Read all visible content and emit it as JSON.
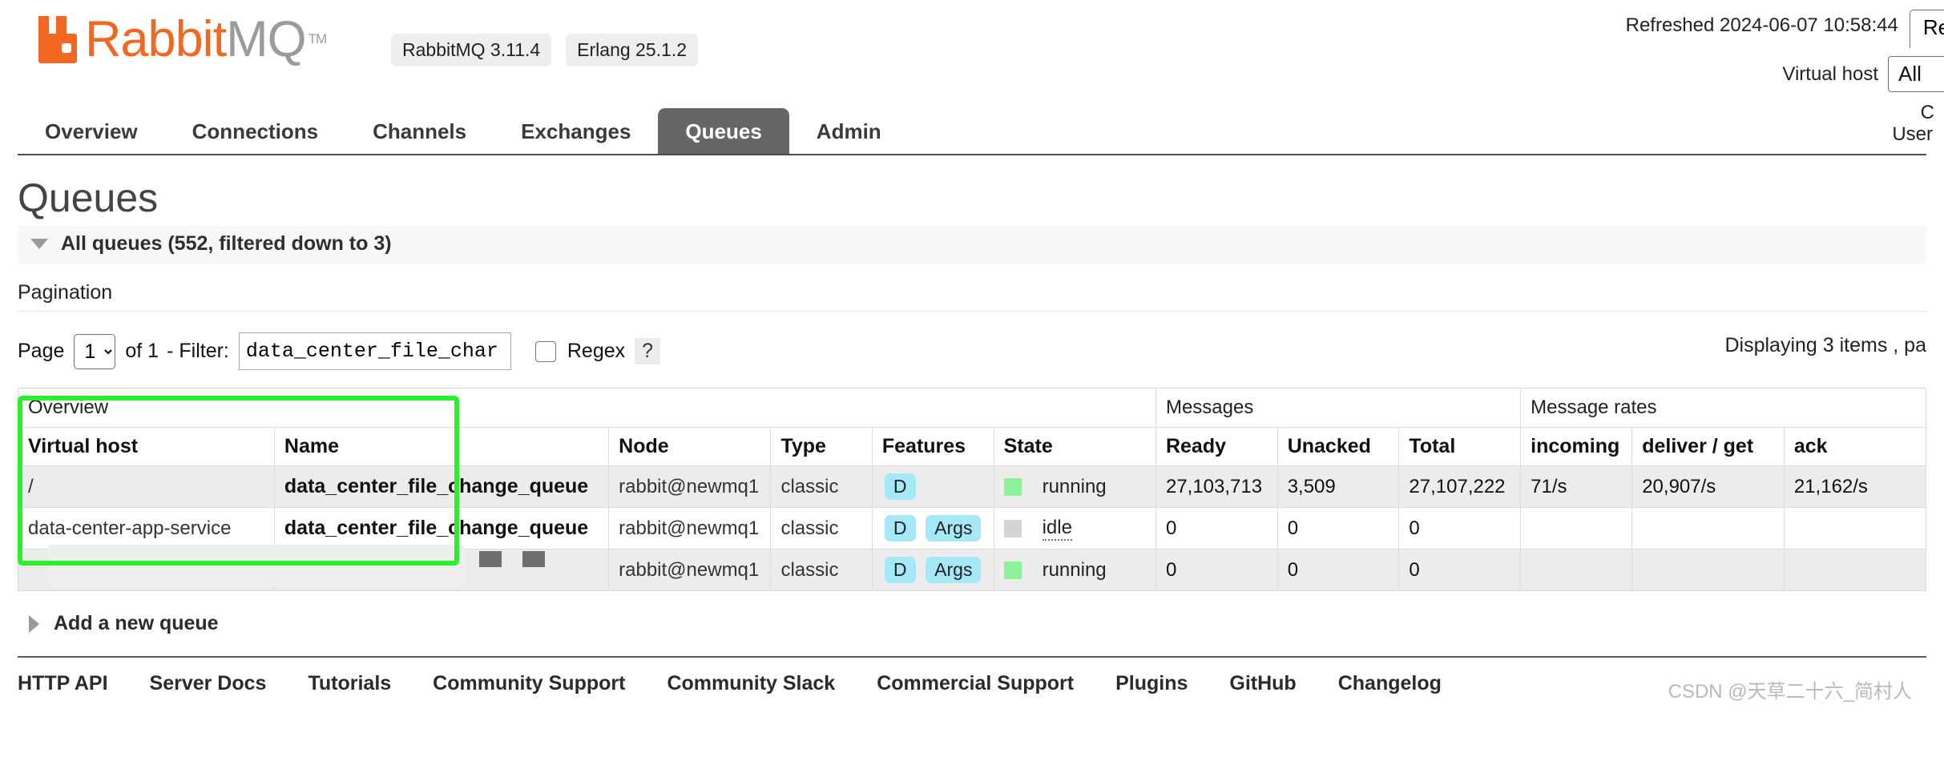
{
  "header": {
    "logo_rabbit": "Rabbit",
    "logo_mq": "MQ",
    "logo_tm": "TM",
    "version_rabbitmq": "RabbitMQ 3.11.4",
    "version_erlang": "Erlang 25.1.2",
    "refreshed_text": "Refreshed 2024-06-07 10:58:44",
    "refresh_button": "Refr",
    "vhost_label": "Virtual host",
    "vhost_value": "All",
    "cluster_partial": "C",
    "user_partial": "User"
  },
  "nav": {
    "tabs": [
      {
        "label": "Overview",
        "active": false
      },
      {
        "label": "Connections",
        "active": false
      },
      {
        "label": "Channels",
        "active": false
      },
      {
        "label": "Exchanges",
        "active": false
      },
      {
        "label": "Queues",
        "active": true
      },
      {
        "label": "Admin",
        "active": false
      }
    ]
  },
  "page": {
    "title": "Queues",
    "section_heading": "All queues (552, filtered down to 3)",
    "pagination_label": "Pagination"
  },
  "pagination": {
    "page_word": "Page",
    "page_value": "1",
    "of_text": "of 1",
    "filter_label": "- Filter:",
    "filter_value": "data_center_file_char",
    "regex_label": "Regex",
    "help": "?",
    "displaying": "Displaying 3 items , pa"
  },
  "table": {
    "group_headers": [
      {
        "label": "Overview",
        "span": 6
      },
      {
        "label": "Messages",
        "span": 3
      },
      {
        "label": "Message rates",
        "span": 3
      }
    ],
    "columns": [
      "Virtual host",
      "Name",
      "Node",
      "Type",
      "Features",
      "State",
      "Ready",
      "Unacked",
      "Total",
      "incoming",
      "deliver / get",
      "ack"
    ],
    "rows": [
      {
        "vhost": "/",
        "name": "data_center_file_change_queue",
        "node": "rabbit@newmq1",
        "type": "classic",
        "features": [
          "D"
        ],
        "state": "running",
        "state_kind": "running",
        "ready": "27,103,713",
        "unacked": "3,509",
        "total": "27,107,222",
        "incoming": "71/s",
        "deliver_get": "20,907/s",
        "ack": "21,162/s"
      },
      {
        "vhost": "data-center-app-service",
        "name": "data_center_file_change_queue",
        "node": "rabbit@newmq1",
        "type": "classic",
        "features": [
          "D",
          "Args"
        ],
        "state": "idle",
        "state_kind": "idle",
        "ready": "0",
        "unacked": "0",
        "total": "0",
        "incoming": "",
        "deliver_get": "",
        "ack": ""
      },
      {
        "vhost": "",
        "name": "",
        "node": "rabbit@newmq1",
        "type": "classic",
        "features": [
          "D",
          "Args"
        ],
        "state": "running",
        "state_kind": "running",
        "ready": "0",
        "unacked": "0",
        "total": "0",
        "incoming": "",
        "deliver_get": "",
        "ack": ""
      }
    ]
  },
  "add_queue": {
    "label": "Add a new queue"
  },
  "footer": {
    "links": [
      "HTTP API",
      "Server Docs",
      "Tutorials",
      "Community Support",
      "Community Slack",
      "Commercial Support",
      "Plugins",
      "GitHub",
      "Changelog"
    ],
    "watermark": "CSDN @天草二十六_简村人"
  },
  "colors": {
    "brand_orange": "#f26722",
    "brand_grey": "#9b9b9b",
    "active_tab": "#666666",
    "badge": "#a5e8f7",
    "running": "#8ef29a",
    "idle": "#d4d4d4",
    "annotation": "#2bef2b"
  }
}
